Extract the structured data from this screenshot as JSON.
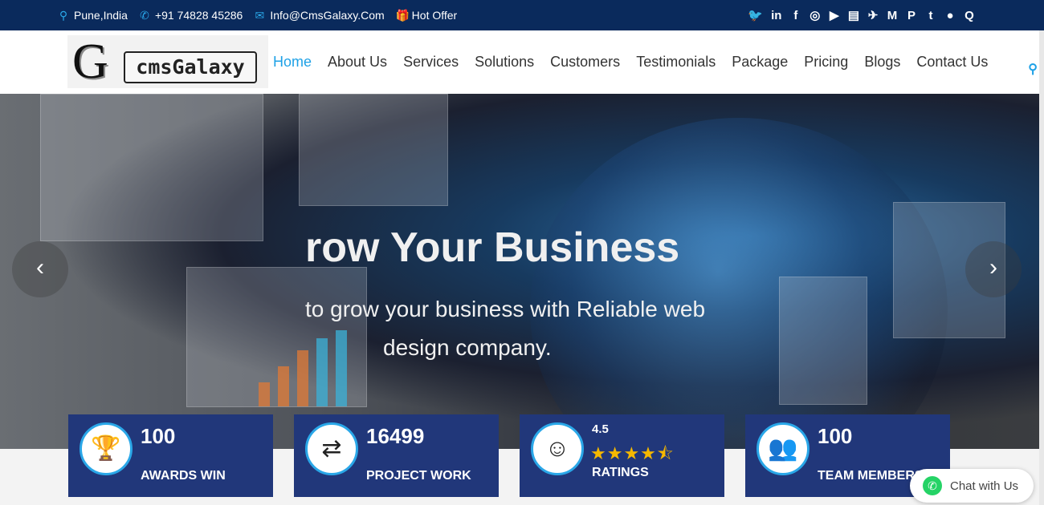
{
  "topbar": {
    "location": "Pune,India",
    "phone": "+91 74828 45286",
    "email": "Info@CmsGalaxy.Com",
    "offer": "Hot Offer",
    "social": [
      {
        "name": "twitter-icon",
        "glyph": "🐦"
      },
      {
        "name": "linkedin-icon",
        "glyph": "in"
      },
      {
        "name": "facebook-icon",
        "glyph": "f"
      },
      {
        "name": "instagram-icon",
        "glyph": "◎"
      },
      {
        "name": "youtube-icon",
        "glyph": "▶"
      },
      {
        "name": "book-icon",
        "glyph": "▤"
      },
      {
        "name": "plane-icon",
        "glyph": "✈"
      },
      {
        "name": "medium-icon",
        "glyph": "M"
      },
      {
        "name": "pinterest-icon",
        "glyph": "P"
      },
      {
        "name": "tumblr-icon",
        "glyph": "t"
      },
      {
        "name": "reddit-icon",
        "glyph": "●"
      },
      {
        "name": "quora-icon",
        "glyph": "Q"
      }
    ]
  },
  "logo": {
    "letter": "G",
    "word": "cmsGalaxy"
  },
  "nav": [
    {
      "label": "Home",
      "active": true
    },
    {
      "label": "About Us"
    },
    {
      "label": "Services"
    },
    {
      "label": "Solutions"
    },
    {
      "label": "Customers"
    },
    {
      "label": "Testimonials"
    },
    {
      "label": "Package"
    },
    {
      "label": "Pricing"
    },
    {
      "label": "Blogs"
    },
    {
      "label": "Contact Us"
    }
  ],
  "hero": {
    "title": "row Your Business",
    "subtitle_line1": "to grow your business with Reliable web",
    "subtitle_line2": "design company.",
    "prev": "‹",
    "next": "›"
  },
  "stats": [
    {
      "value": "100",
      "label": "AWARDS WIN",
      "icon": "trophy-icon",
      "glyph": "🏆"
    },
    {
      "value": "16499",
      "label": "PROJECT WORK",
      "icon": "repeat-icon",
      "glyph": "⇄"
    },
    {
      "value": "4.5",
      "label": "RATINGS",
      "icon": "smile-icon",
      "glyph": "☺",
      "stars": "★★★★⯪"
    },
    {
      "value": "100",
      "label": "TEAM MEMBERS",
      "icon": "users-icon",
      "glyph": "👥"
    }
  ],
  "chat": {
    "label": "Chat with Us"
  },
  "colors": {
    "topbar": "#0a2a5c",
    "accent": "#1ea1e6",
    "card": "#21377a",
    "star": "#f5b800"
  }
}
